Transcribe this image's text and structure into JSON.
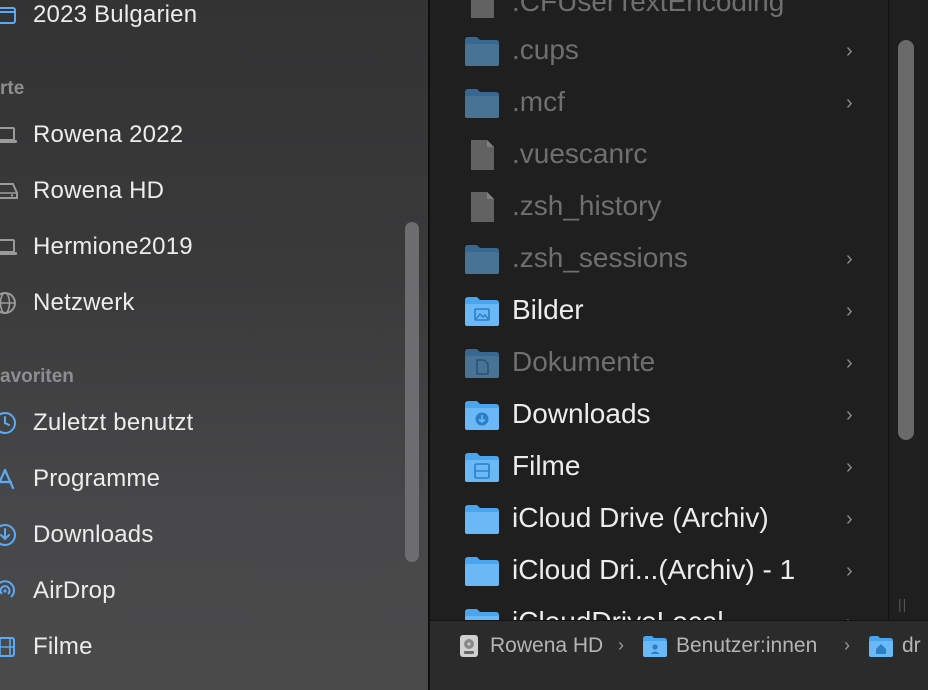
{
  "sidebar": {
    "top_item": {
      "label": "2023 Bulgarien",
      "icon": "folder-icon"
    },
    "locations_header": "rte",
    "locations": [
      {
        "label": "Rowena 2022",
        "icon": "laptop-icon"
      },
      {
        "label": "Rowena HD",
        "icon": "harddrive-icon"
      },
      {
        "label": "Hermione2019",
        "icon": "laptop-icon"
      },
      {
        "label": "Netzwerk",
        "icon": "network-icon"
      }
    ],
    "favorites_header": "avoriten",
    "favorites": [
      {
        "label": "Zuletzt benutzt",
        "icon": "clock-icon"
      },
      {
        "label": "Programme",
        "icon": "apps-icon"
      },
      {
        "label": "Downloads",
        "icon": "download-icon"
      },
      {
        "label": "AirDrop",
        "icon": "airdrop-icon"
      },
      {
        "label": "Filme",
        "icon": "film-icon"
      }
    ]
  },
  "files": [
    {
      "name": ".CFUserTextEncoding",
      "kind": "document",
      "hidden": true,
      "has_children": false
    },
    {
      "name": ".cups",
      "kind": "folder",
      "hidden": true,
      "has_children": true
    },
    {
      "name": ".mcf",
      "kind": "folder",
      "hidden": true,
      "has_children": true
    },
    {
      "name": ".vuescanrc",
      "kind": "document",
      "hidden": true,
      "has_children": false
    },
    {
      "name": ".zsh_history",
      "kind": "document",
      "hidden": true,
      "has_children": false
    },
    {
      "name": ".zsh_sessions",
      "kind": "folder",
      "hidden": true,
      "has_children": true
    },
    {
      "name": "Bilder",
      "kind": "folder-pictures",
      "hidden": false,
      "has_children": true
    },
    {
      "name": "Dokumente",
      "kind": "folder-documents",
      "hidden": true,
      "has_children": true
    },
    {
      "name": "Downloads",
      "kind": "folder-downloads",
      "hidden": false,
      "has_children": true
    },
    {
      "name": "Filme",
      "kind": "folder-movies",
      "hidden": false,
      "has_children": true
    },
    {
      "name": "iCloud Drive (Archiv)",
      "kind": "folder",
      "hidden": false,
      "has_children": true
    },
    {
      "name": "iCloud Dri...(Archiv) - 1",
      "kind": "folder",
      "hidden": false,
      "has_children": true
    },
    {
      "name": "iCloudDriveLocal",
      "kind": "folder",
      "hidden": false,
      "has_children": true
    }
  ],
  "chevron": "›",
  "pathbar": {
    "crumbs": [
      {
        "label": "Rowena HD",
        "icon": "harddrive-icon"
      },
      {
        "label": "Benutzer:innen",
        "icon": "users-folder-icon"
      },
      {
        "label": "dr",
        "icon": "home-folder-icon"
      }
    ],
    "separator": "›"
  },
  "colors": {
    "folder_blue": "#4aa5f0",
    "folder_dim": "#3a6a92",
    "accent": "#5aaaf5"
  }
}
